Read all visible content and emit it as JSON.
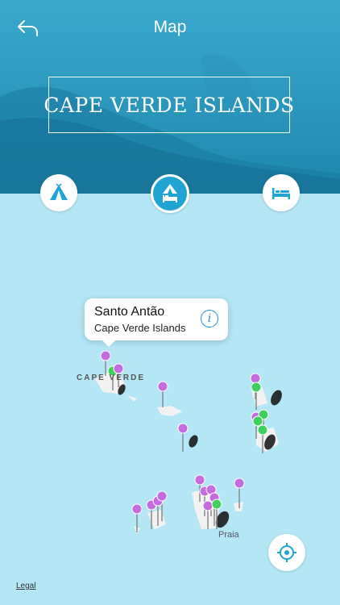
{
  "nav": {
    "title": "Map",
    "back_icon": "back-arrow-icon"
  },
  "banner": {
    "title": "CAPE VERDE ISLANDS"
  },
  "filters": [
    {
      "icon": "tent-icon",
      "state": "normal"
    },
    {
      "icon": "tent-bed-icon",
      "state": "selected"
    },
    {
      "icon": "bed-icon",
      "state": "normal"
    }
  ],
  "callout": {
    "title": "Santo Antão",
    "subtitle": "Cape Verde Islands",
    "info_icon": "info-icon"
  },
  "map": {
    "country_label": "CAPE VERDE",
    "city_label": "Praia",
    "legal": "Legal",
    "locate_icon": "locate-icon"
  },
  "colors": {
    "pin_purple": "#c66ae0",
    "pin_green": "#3fd15c",
    "selected_button": "#1fa4d4",
    "sea": "#b4e6f6"
  }
}
